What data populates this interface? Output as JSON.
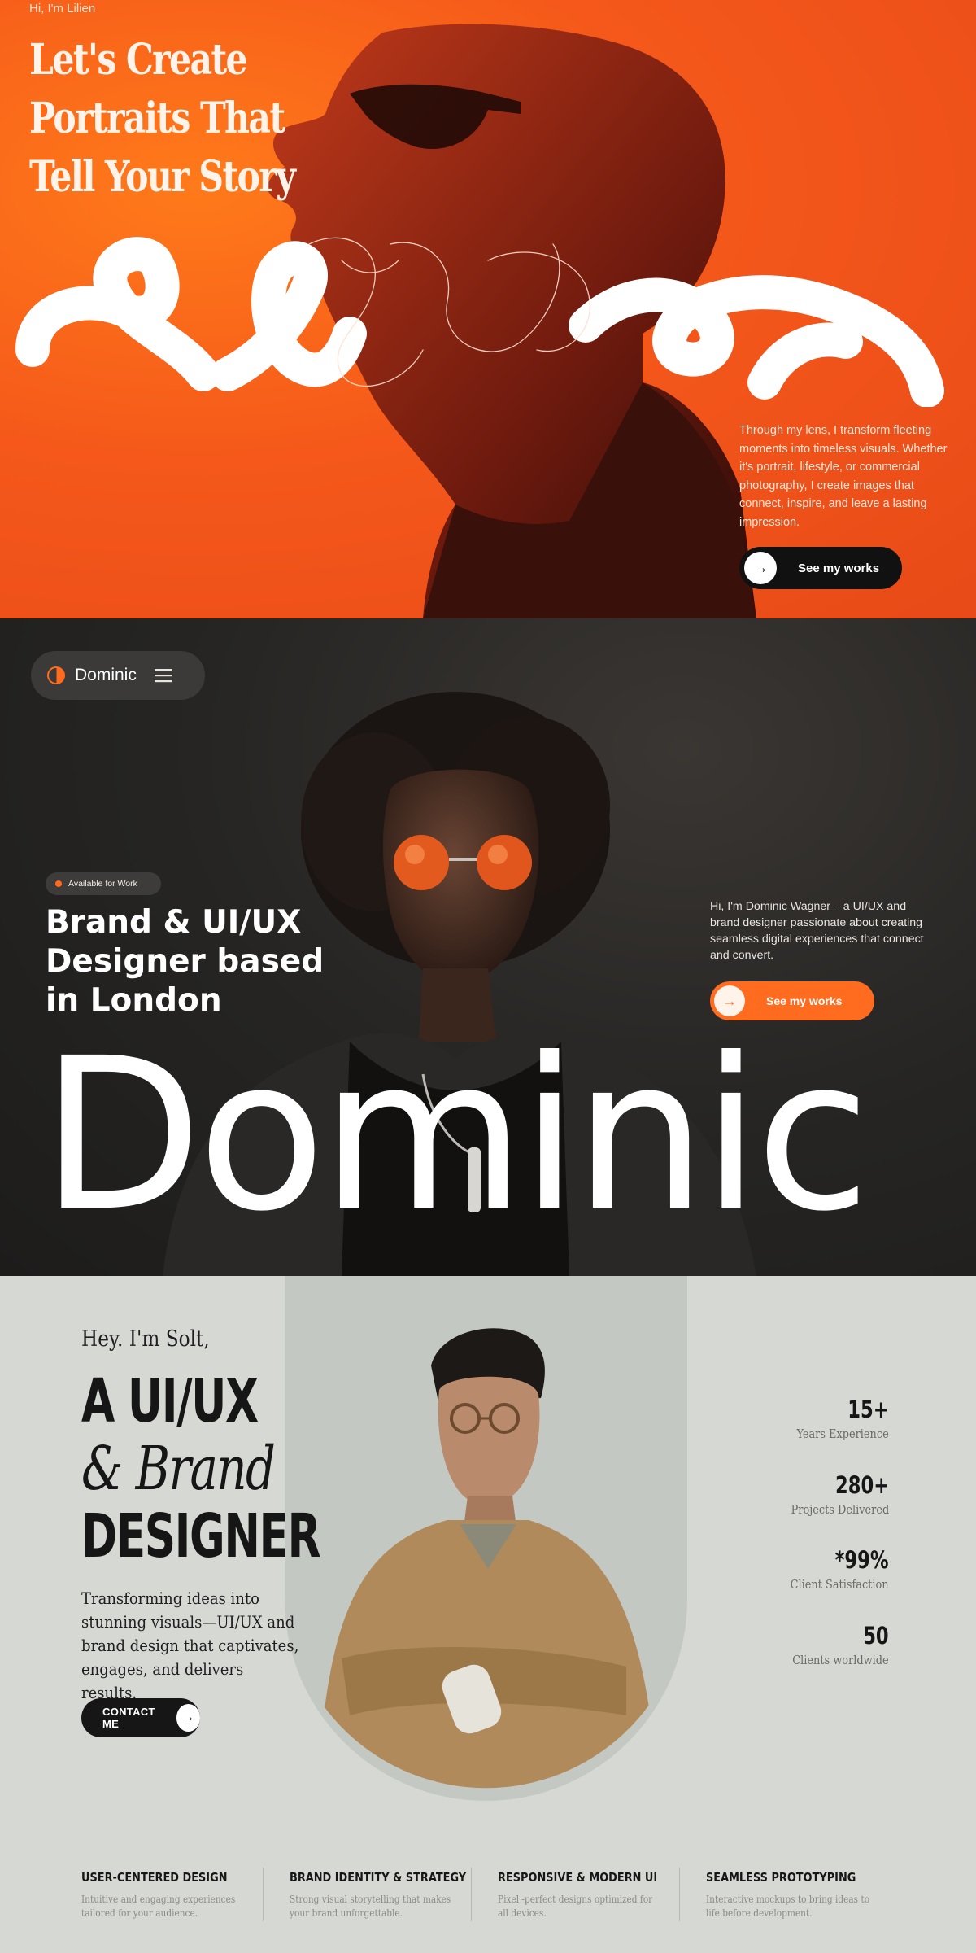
{
  "lilien": {
    "greeting": "Hi, I'm Lilien",
    "headline": [
      "Let's Create",
      "Portraits That",
      "Tell Your Story"
    ],
    "script_name": "Lilien",
    "description": "Through my lens, I transform fleeting moments into timeless visuals. Whether it's portrait, lifestyle, or commercial photography, I create images that connect, inspire, and leave a lasting impression.",
    "cta_label": "See my works",
    "colors": {
      "background": "#f5581a",
      "button": "#111111"
    }
  },
  "dominic": {
    "nav_name": "Dominic",
    "badge": "Available for Work",
    "headline": "Brand & UI/UX Designer based in London",
    "description": "Hi, I'm Dominic Wagner – a UI/UX and brand designer passionate about creating seamless digital experiences that connect and convert.",
    "cta_label": "See my works",
    "big_name": "Dominic",
    "colors": {
      "accent": "#ff6b1f",
      "background": "#262523"
    }
  },
  "solt": {
    "greeting": "Hey. I'm Solt,",
    "title_line1": "A UI/UX",
    "title_line2": "& Brand",
    "title_line3": "DESIGNER",
    "description": "Transforming ideas into stunning visuals—UI/UX and brand design that captivates, engages, and delivers results.",
    "cta_label": "CONTACT ME",
    "stats": [
      {
        "value": "15+",
        "label": "Years Experience"
      },
      {
        "value": "280+",
        "label": "Projects Delivered"
      },
      {
        "value": "*99%",
        "label": "Client Satisfaction"
      },
      {
        "value": "50",
        "label": "Clients worldwide"
      }
    ],
    "features": [
      {
        "title": "USER-CENTERED DESIGN",
        "text": "Intuitive and engaging experiences tailored for your audience."
      },
      {
        "title": "BRAND IDENTITY & STRATEGY",
        "text": "Strong visual storytelling that makes your brand unforgettable."
      },
      {
        "title": "RESPONSIVE & MODERN UI",
        "text": "Pixel -perfect designs optimized for all devices."
      },
      {
        "title": "SEAMLESS PROTOTYPING",
        "text": "Interactive mockups to bring ideas to life before development."
      }
    ],
    "colors": {
      "background": "#d6d8d3",
      "arch": "#c3c8c2"
    }
  }
}
